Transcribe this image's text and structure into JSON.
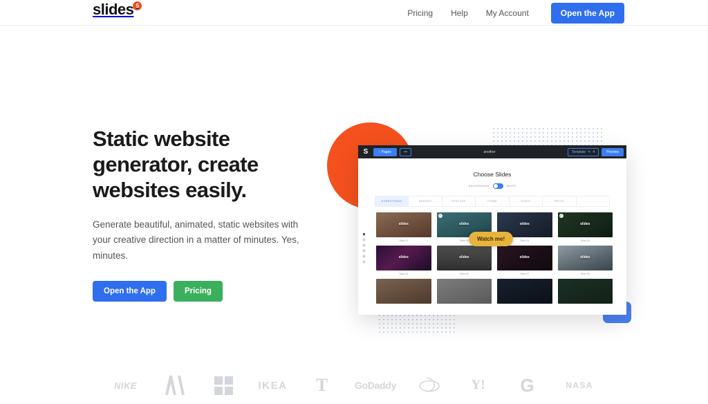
{
  "header": {
    "logo": {
      "text": "slides",
      "badge": "5",
      "badge_color": "#f4511e"
    },
    "nav": [
      {
        "label": "Pricing",
        "name": "nav-link-pricing"
      },
      {
        "label": "Help",
        "name": "nav-link-help"
      },
      {
        "label": "My Account",
        "name": "nav-link-my-account"
      }
    ],
    "cta": {
      "label": "Open the App",
      "color": "#2f6fed"
    }
  },
  "hero": {
    "headline": "Static website generator, create websites easily.",
    "subhead": "Generate beautiful, animated, static websites with your creative direction in a matter of minutes. Yes, minutes.",
    "buttons": [
      {
        "label": "Open the App",
        "color": "#2f6fed"
      },
      {
        "label": "Pricing",
        "color": "#3aaf5c"
      }
    ],
    "decorations": {
      "circle_color": "#f4511e",
      "dot_color": "#b9c6e8",
      "square_color": "#4a80ef"
    }
  },
  "mockup": {
    "toolbar": {
      "logo": "S",
      "pages_label": "Pages",
      "back_chevron": "‹",
      "more_label": "•••",
      "title": "another",
      "template_label": "Template",
      "template_count": "4",
      "pencil_icon": "✎",
      "preview_label": "Preview"
    },
    "heading": "Choose Slides",
    "toggle": {
      "left_label": "BACKGROUND",
      "right_label": "WHITE",
      "on": true
    },
    "tabs": [
      {
        "label": "EVERYTHING",
        "active": true
      },
      {
        "label": "HEADER",
        "active": false
      },
      {
        "label": "FEATURE",
        "active": false
      },
      {
        "label": "FORM",
        "active": false
      },
      {
        "label": "VIDEO",
        "active": false
      },
      {
        "label": "PRICE",
        "active": false
      },
      {
        "label": "…",
        "active": false
      }
    ],
    "slides": [
      {
        "caption": "Slide 01",
        "logo": "slides",
        "checked": false,
        "bg": "linear-gradient(160deg,#8a6b55,#6e4f3c 55%,#54392a)"
      },
      {
        "caption": "Slide 02",
        "logo": "slides",
        "checked": true,
        "bg": "linear-gradient(160deg,#3c6d72,#2a565c 60%,#1d3c44)"
      },
      {
        "caption": "Slide 03",
        "logo": "slides",
        "checked": false,
        "bg": "linear-gradient(150deg,#2c3a51,#1d2736 60%,#141b27)"
      },
      {
        "caption": "Slide 04",
        "logo": "slides",
        "checked": true,
        "bg": "linear-gradient(150deg,#20351f,#16291a 60%,#0e1b10)"
      },
      {
        "caption": "Slide 05",
        "logo": "slides",
        "checked": false,
        "bg": "linear-gradient(140deg,#2a1036,#561a4e 45%,#1a0b25)"
      },
      {
        "caption": "Slide 06",
        "logo": "slides",
        "checked": false,
        "bg": "linear-gradient(180deg,#4c4c4c,#3d3d3d 60%,#2e2e2e)"
      },
      {
        "caption": "Slide 07",
        "logo": "slides",
        "checked": false,
        "bg": "linear-gradient(150deg,#2a1620,#1a0e16 55%,#120a10)"
      },
      {
        "caption": "Slide 08",
        "logo": "slides",
        "checked": false,
        "bg": "linear-gradient(160deg,#8f9aa1,#5d6a72 55%,#39434a)"
      },
      {
        "caption": "",
        "logo": "",
        "checked": false,
        "bg": "linear-gradient(160deg,#7a6250,#4d3a2c)"
      },
      {
        "caption": "",
        "logo": "",
        "checked": false,
        "bg": "linear-gradient(160deg,#7c7c7c,#5a5a5a)"
      },
      {
        "caption": "",
        "logo": "",
        "checked": false,
        "bg": "linear-gradient(160deg,#16202e,#0b1118)"
      },
      {
        "caption": "",
        "logo": "",
        "checked": false,
        "bg": "linear-gradient(160deg,#1a3026,#132018)"
      }
    ],
    "rail_dots": 6,
    "tooltip": {
      "label": "Watch me!",
      "color": "#e8b33c"
    }
  },
  "logo_strip": {
    "brands": [
      {
        "name": "nike",
        "label": "NIKE"
      },
      {
        "name": "adobe",
        "label": "A"
      },
      {
        "name": "microsoft",
        "label": ""
      },
      {
        "name": "ikea",
        "label": "IKEA"
      },
      {
        "name": "tmobile",
        "label": "T"
      },
      {
        "name": "godaddy",
        "label": "GoDaddy"
      },
      {
        "name": "disney",
        "label": "D"
      },
      {
        "name": "yahoo",
        "label": "Y!"
      },
      {
        "name": "google",
        "label": "G"
      },
      {
        "name": "nasa",
        "label": "NASA"
      }
    ]
  }
}
